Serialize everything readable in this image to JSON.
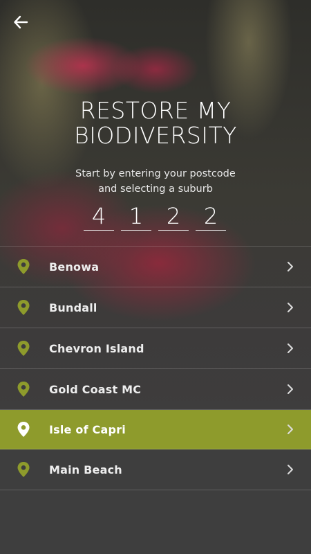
{
  "header": {
    "back_icon": "arrow-left-icon"
  },
  "title": {
    "line1": "RESTORE MY",
    "line2": "BIODIVERSITY"
  },
  "subtitle": {
    "line1": "Start by entering your postcode",
    "line2": "and selecting a suburb"
  },
  "postcode": {
    "digits": [
      "4",
      "1",
      "2",
      "2"
    ]
  },
  "suburbs": {
    "items": [
      {
        "label": "Benowa",
        "selected": false
      },
      {
        "label": "Bundall",
        "selected": false
      },
      {
        "label": "Chevron Island",
        "selected": false
      },
      {
        "label": "Gold Coast MC",
        "selected": false
      },
      {
        "label": "Isle of Capri",
        "selected": true
      },
      {
        "label": "Main Beach",
        "selected": false
      }
    ],
    "pin_icon": "map-pin-icon",
    "chevron_icon": "chevron-right-icon"
  },
  "colors": {
    "accent": "#8e9b2c",
    "pin": "#8e9b2c",
    "pin_selected": "#ffffff",
    "text": "#ffffff"
  }
}
